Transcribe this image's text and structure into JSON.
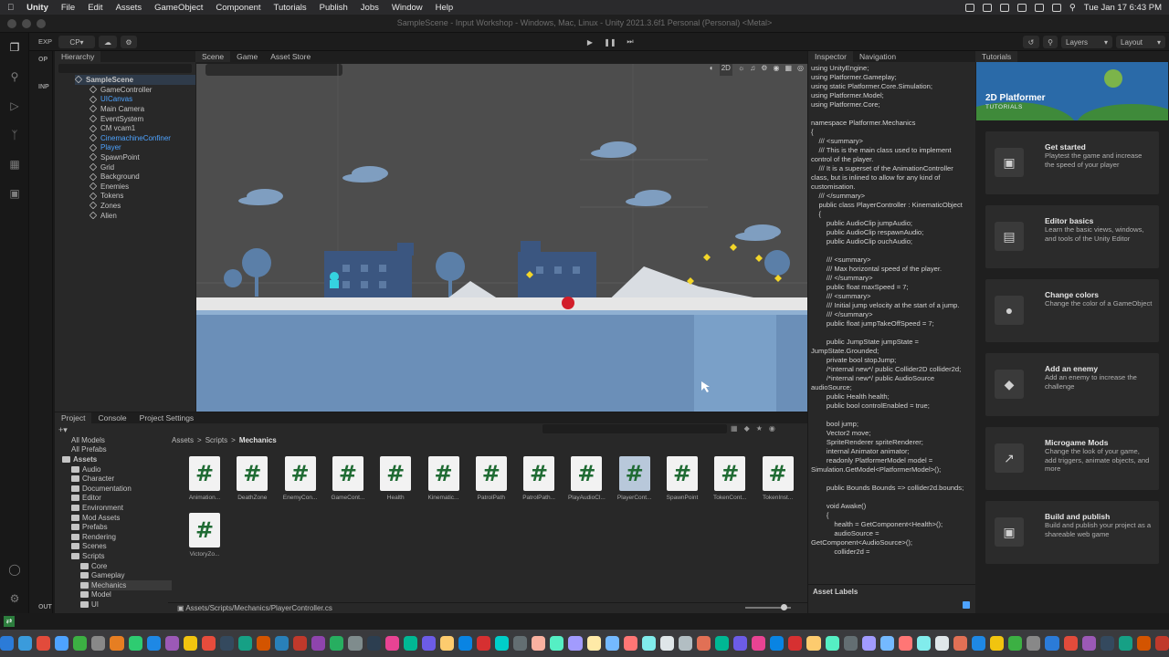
{
  "menubar": {
    "app": "Unity",
    "items": [
      "File",
      "Edit",
      "Assets",
      "GameObject",
      "Component",
      "Tutorials",
      "Publish",
      "Jobs",
      "Window",
      "Help"
    ],
    "clock": "Tue Jan 17  6:43 PM"
  },
  "window_title": "SampleScene - Input Workshop - Windows, Mac, Linux - Unity 2021.3.6f1 Personal (Personal) <Metal>",
  "toolbar": {
    "account": "CP",
    "layers_label": "Layers",
    "layout_label": "Layout"
  },
  "vscode_side": {
    "explorer_label": "EXP"
  },
  "edge_labels": [
    "OP",
    "INP",
    "OUT"
  ],
  "hierarchy": {
    "tab_label": "Hierarchy",
    "scene_name": "SampleScene",
    "items": [
      {
        "label": "GameController",
        "blue": false
      },
      {
        "label": "UICanvas",
        "blue": true
      },
      {
        "label": "Main Camera",
        "blue": false
      },
      {
        "label": "EventSystem",
        "blue": false
      },
      {
        "label": "CM vcam1",
        "blue": false
      },
      {
        "label": "CinemachineConfiner",
        "blue": true
      },
      {
        "label": "Player",
        "blue": true
      },
      {
        "label": "SpawnPoint",
        "blue": false
      },
      {
        "label": "Grid",
        "blue": false
      },
      {
        "label": "Background",
        "blue": false
      },
      {
        "label": "Enemies",
        "blue": false
      },
      {
        "label": "Tokens",
        "blue": false
      },
      {
        "label": "Zones",
        "blue": false
      },
      {
        "label": "Alien",
        "blue": false
      }
    ]
  },
  "scene_tabs": [
    "Scene",
    "Game",
    "Asset Store"
  ],
  "scene_toolbar": {
    "mode_2d": "2D"
  },
  "inspector": {
    "tabs": [
      "Inspector",
      "Navigation"
    ],
    "asset_labels": "Asset Labels",
    "code": "using UnityEngine;\nusing Platformer.Gameplay;\nusing static Platformer.Core.Simulation;\nusing Platformer.Model;\nusing Platformer.Core;\n\nnamespace Platformer.Mechanics\n{\n    /// <summary>\n    /// This is the main class used to implement control of the player.\n    /// It is a superset of the AnimationController class, but is inlined to allow for any kind of customisation.\n    /// </summary>\n    public class PlayerController : KinematicObject\n    {\n        public AudioClip jumpAudio;\n        public AudioClip respawnAudio;\n        public AudioClip ouchAudio;\n\n        /// <summary>\n        /// Max horizontal speed of the player.\n        /// </summary>\n        public float maxSpeed = 7;\n        /// <summary>\n        /// Initial jump velocity at the start of a jump.\n        /// </summary>\n        public float jumpTakeOffSpeed = 7;\n\n        public JumpState jumpState = JumpState.Grounded;\n        private bool stopJump;\n        /*internal new*/ public Collider2D collider2d;\n        /*internal new*/ public AudioSource audioSource;\n        public Health health;\n        public bool controlEnabled = true;\n\n        bool jump;\n        Vector2 move;\n        SpriteRenderer spriteRenderer;\n        internal Animator animator;\n        readonly PlatformerModel model = Simulation.GetModel<PlatformerModel>();\n\n        public Bounds Bounds => collider2d.bounds;\n\n        void Awake()\n        {\n            health = GetComponent<Health>();\n            audioSource = GetComponent<AudioSource>();\n            collider2d ="
  },
  "tutorials": {
    "tab_label": "Tutorials",
    "banner_title": "2D Platformer",
    "banner_sub": "TUTORIALS",
    "cards": [
      {
        "title": "Get started",
        "desc": "Playtest the game and increase the speed of your player",
        "icon": "gamepad-icon"
      },
      {
        "title": "Editor basics",
        "desc": "Learn the basic views, windows, and tools of the Unity Editor",
        "icon": "editor-window-icon"
      },
      {
        "title": "Change colors",
        "desc": "Change the color of a GameObject",
        "icon": "color-swatch-icon"
      },
      {
        "title": "Add an enemy",
        "desc": "Add an enemy to increase the challenge",
        "icon": "enemy-icon"
      },
      {
        "title": "Microgame Mods",
        "desc": "Change the look of your game, add triggers, animate objects, and more",
        "icon": "external-link-icon"
      },
      {
        "title": "Build and publish",
        "desc": "Build and publish your project as a shareable web game",
        "icon": "web-gamepad-icon"
      }
    ]
  },
  "project": {
    "tabs": [
      "Project",
      "Console",
      "Project Settings"
    ],
    "breadcrumb": [
      "Assets",
      "Scripts",
      "Mechanics"
    ],
    "path": "Assets/Scripts/Mechanics/PlayerController.cs",
    "tree": [
      {
        "label": "All Models",
        "indent": 1,
        "folder": false
      },
      {
        "label": "All Prefabs",
        "indent": 1,
        "folder": false
      },
      {
        "label": "Assets",
        "indent": 0,
        "folder": true,
        "bold": true
      },
      {
        "label": "Audio",
        "indent": 1,
        "folder": true
      },
      {
        "label": "Character",
        "indent": 1,
        "folder": true
      },
      {
        "label": "Documentation",
        "indent": 1,
        "folder": true
      },
      {
        "label": "Editor",
        "indent": 1,
        "folder": true
      },
      {
        "label": "Environment",
        "indent": 1,
        "folder": true
      },
      {
        "label": "Mod Assets",
        "indent": 1,
        "folder": true
      },
      {
        "label": "Prefabs",
        "indent": 1,
        "folder": true
      },
      {
        "label": "Rendering",
        "indent": 1,
        "folder": true
      },
      {
        "label": "Scenes",
        "indent": 1,
        "folder": true
      },
      {
        "label": "Scripts",
        "indent": 1,
        "folder": true
      },
      {
        "label": "Core",
        "indent": 2,
        "folder": true
      },
      {
        "label": "Gameplay",
        "indent": 2,
        "folder": true
      },
      {
        "label": "Mechanics",
        "indent": 2,
        "folder": true,
        "selected": true
      },
      {
        "label": "Model",
        "indent": 2,
        "folder": true
      },
      {
        "label": "UI",
        "indent": 2,
        "folder": true
      }
    ],
    "assets": [
      "Animation...",
      "DeathZone",
      "EnemyCon...",
      "GameCont...",
      "Health",
      "Kinematic...",
      "PatrolPath",
      "PatrolPath...",
      "PlayAudioCl...",
      "PlayerCont...",
      "SpawnPoint",
      "TokenCont...",
      "TokenInst...",
      "VictoryZo..."
    ],
    "selected_asset": "PlayerCont...",
    "asset_glyph": "#"
  },
  "colors": {
    "accent": "#4ea3ff",
    "scene_sky": "#4d4d4d",
    "ground": "#6b8fb8"
  }
}
